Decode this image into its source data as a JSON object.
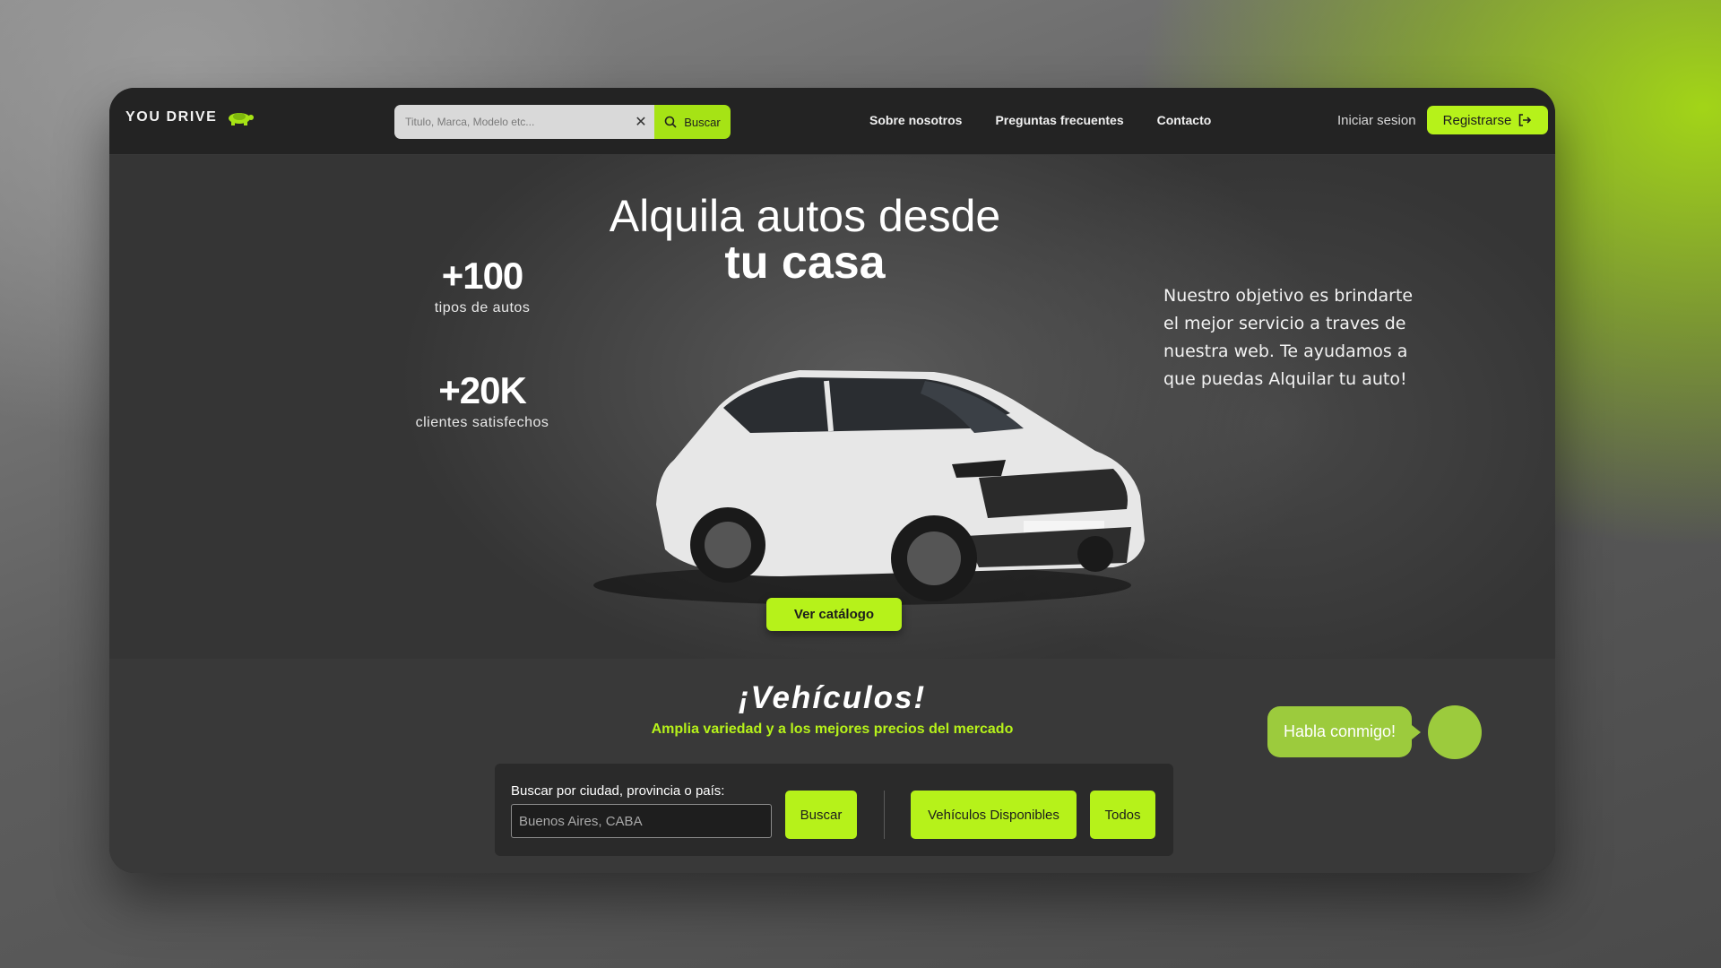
{
  "brand": {
    "name": "YOU DRIVE",
    "accent": "#b6f21a"
  },
  "search": {
    "placeholder": "Titulo, Marca, Modelo etc...",
    "button_label": "Buscar"
  },
  "nav": {
    "links": [
      "Sobre nosotros",
      "Preguntas frecuentes",
      "Contacto"
    ],
    "login_label": "Iniciar sesion",
    "register_label": "Registrarse"
  },
  "hero": {
    "title_line1": "Alquila autos desde",
    "title_line2": "tu casa",
    "stats": [
      {
        "value": "+100",
        "label": "tipos de autos"
      },
      {
        "value": "+20K",
        "label": "clientes satisfechos"
      }
    ],
    "description": "Nuestro objetivo es brindarte el mejor servicio a traves de nuestra web. Te ayudamos a que puedas Alquilar tu auto!",
    "catalog_button": "Ver catálogo"
  },
  "vehicles": {
    "title": "¡Vehículos!",
    "subtitle": "Amplia variedad y a los mejores precios del mercado",
    "filter": {
      "label": "Buscar por ciudad, provincia o país:",
      "placeholder": "Buenos Aires, CABA",
      "search_button": "Buscar",
      "available_button": "Vehículos Disponibles",
      "all_button": "Todos"
    }
  },
  "chat": {
    "label": "Habla conmigo!"
  }
}
